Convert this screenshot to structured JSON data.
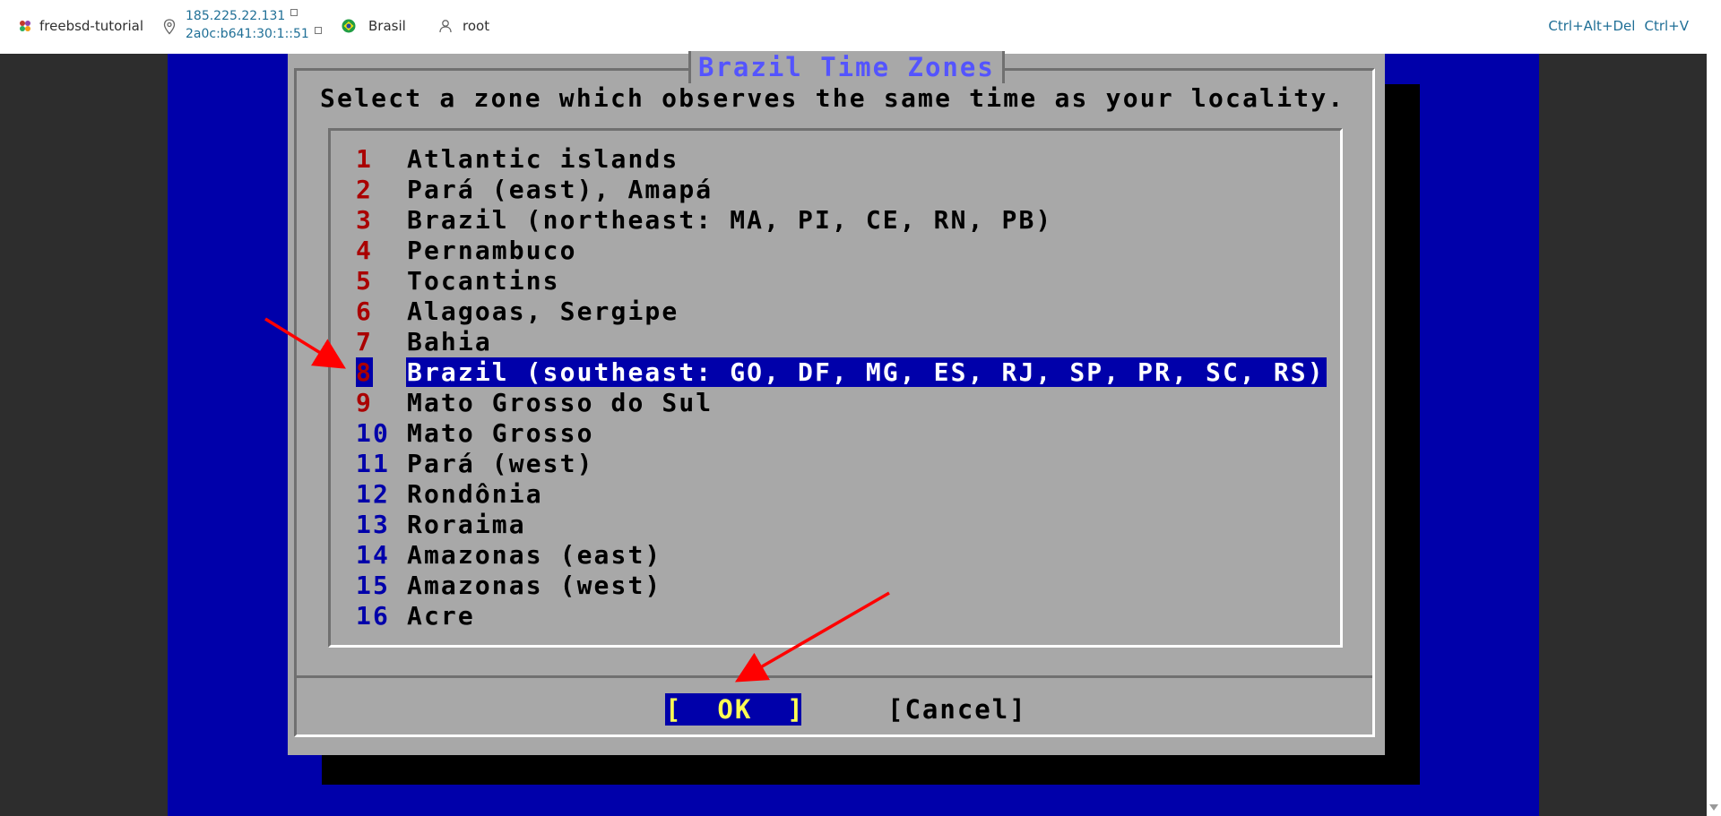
{
  "topbar": {
    "server_name": "freebsd-tutorial",
    "ipv4": "185.225.22.131",
    "ipv6": "2a0c:b641:30:1::51",
    "location": "Brasil",
    "user": "root",
    "shortcut_cad": "Ctrl+Alt+Del",
    "shortcut_cv": "Ctrl+V"
  },
  "dialog": {
    "title": "Brazil Time Zones",
    "prompt": "Select a zone which observes the same time as your locality.",
    "items": [
      {
        "num": "1",
        "label": "Atlantic islands"
      },
      {
        "num": "2",
        "label": "Pará (east), Amapá"
      },
      {
        "num": "3",
        "label": "Brazil (northeast: MA, PI, CE, RN, PB)"
      },
      {
        "num": "4",
        "label": "Pernambuco"
      },
      {
        "num": "5",
        "label": "Tocantins"
      },
      {
        "num": "6",
        "label": "Alagoas, Sergipe"
      },
      {
        "num": "7",
        "label": "Bahia"
      },
      {
        "num": "8",
        "label": "Brazil (southeast: GO, DF, MG, ES, RJ, SP, PR, SC, RS)"
      },
      {
        "num": "9",
        "label": "Mato Grosso do Sul"
      },
      {
        "num": "10",
        "label": "Mato Grosso"
      },
      {
        "num": "11",
        "label": "Pará (west)"
      },
      {
        "num": "12",
        "label": "Rondônia"
      },
      {
        "num": "13",
        "label": "Roraima"
      },
      {
        "num": "14",
        "label": "Amazonas (east)"
      },
      {
        "num": "15",
        "label": "Amazonas (west)"
      },
      {
        "num": "16",
        "label": "Acre"
      }
    ],
    "selected_index": 7,
    "ok_label": "[  OK  ]",
    "cancel_label": "[Cancel]"
  },
  "colors": {
    "console_bg": "#0000aa",
    "dialog_bg": "#a8a8a8",
    "title": "#5454ff",
    "hotkey_red": "#aa0000",
    "hotkey_blue": "#0000aa",
    "ok_text": "#ffff54",
    "annotation_arrow": "#ff0000"
  },
  "icons": {
    "logo": "app-logo-icon",
    "location": "location-pin-icon",
    "flag": "brazil-flag-icon",
    "user": "user-icon",
    "copy": "copy-icon"
  }
}
